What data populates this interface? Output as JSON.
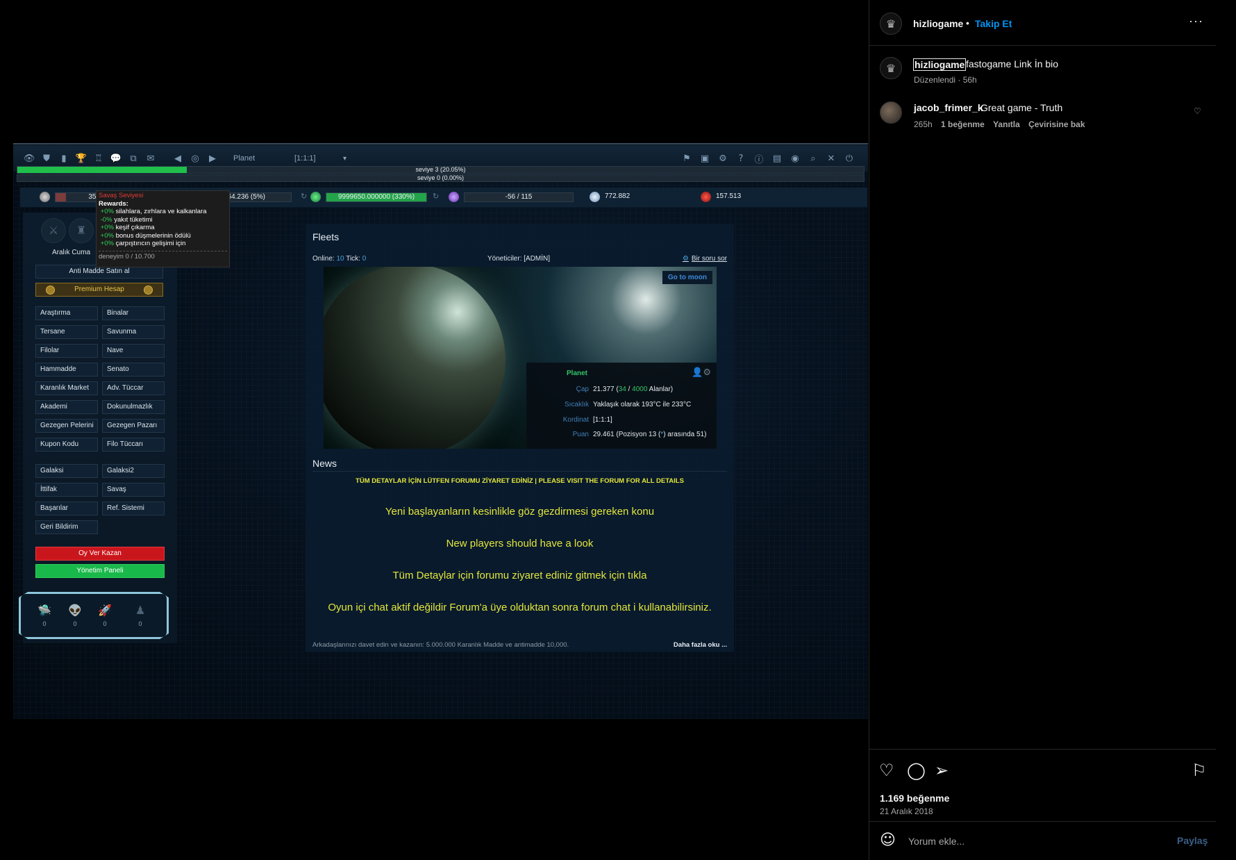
{
  "post": {
    "username": "hizliogame",
    "separator": "•",
    "follow": "Takip Et",
    "more": "···",
    "caption_username": "hizliogame",
    "caption_text": "fastogame Link İn bio",
    "caption_meta": "Düzenlendi · 56h",
    "comment": {
      "username": "jacob_frimer_k",
      "text": "Great game - Truth",
      "time": "265h",
      "likes": "1 beğenme",
      "reply": "Yanıtla",
      "translate": "Çevirisine bak"
    },
    "likes": "1.169 beğenme",
    "date": "21 Aralık 2018",
    "comment_placeholder": "Yorum ekle...",
    "share": "Paylaş",
    "icons": [
      "like-icon",
      "comment-icon",
      "share-icon",
      "save-icon",
      "emoji-icon"
    ]
  },
  "game": {
    "toolbar": {
      "planet": "Planet",
      "coord": "[1:1:1]",
      "dropdown": "▾"
    },
    "level_bars": [
      {
        "label": "seviye 3 (20.05%)",
        "progress": 0.2005
      },
      {
        "label": "seviye 0 (0.00%)",
        "progress": 0.0
      }
    ],
    "resources": {
      "metal": "353",
      "crystal": "164.236 (5%)",
      "deuterium": "9999650.000000 (330%)",
      "deuterium_progress": 1.0,
      "energy": "-56 / 115",
      "dark_matter": "772.882",
      "antimatter": "157.513"
    },
    "tooltip": {
      "title": "Savaş Seviyesi",
      "rewards": "Rewards:",
      "lines": [
        {
          "pct": "+0%",
          "text": "silahlara, zırhlara ve kalkanlara"
        },
        {
          "pct": "-0%",
          "text": "yakıt tüketimi"
        },
        {
          "pct": "+0%",
          "text": "keşif çıkarma"
        },
        {
          "pct": "+0%",
          "text": "bonus düşmelerinin ödülü"
        },
        {
          "pct": "+0%",
          "text": "çarpıştırıcın gelişimi için"
        }
      ],
      "exp": "deneyim 0 / 10.700"
    },
    "user": "Aralık Cuma",
    "menu": {
      "buy_am": "Anti Madde Satın al",
      "premium": "Premium Hesap",
      "left": [
        "Araştırma",
        "Tersane",
        "Filolar",
        "Hammadde",
        "Karanlık Market",
        "Akademi",
        "Gezegen Pelerini",
        "Kupon Kodu"
      ],
      "right": [
        "Binalar",
        "Savunma",
        "Nave",
        "Senato",
        "Adv. Tüccar",
        "Dokunulmazlık",
        "Gezegen Pazarı",
        "Filo Tüccarı"
      ],
      "left2": [
        "Galaksi",
        "İttifak",
        "Başarılar",
        "Geri Bildirim"
      ],
      "right2": [
        "Galaksi2",
        "Savaş",
        "Ref. Sistemi"
      ],
      "vote": "Oy Ver Kazan",
      "admin": "Yönetim Paneli",
      "ships": [
        "0",
        "0",
        "0",
        "0"
      ]
    },
    "main": {
      "fleets": "Fleets",
      "online_label": "Online:",
      "online_value": "10",
      "tick_label": "Tick:",
      "tick_value": "0",
      "admins": "Yöneticiler: [ADMİN]",
      "ask": "Bir soru sor",
      "go_moon": "Go to moon",
      "planet": {
        "title": "Planet",
        "cap_label": "Çap",
        "cap_pre": "21.377 (",
        "cap_used": "34",
        "cap_sep": " / ",
        "cap_total": "4000",
        "cap_post": " Alanlar)",
        "temp_label": "Sıcaklık",
        "temp": "Yaklaşık olarak 193°C ile 233°C",
        "coord_label": "Kordinat",
        "coord": "[1:1:1]",
        "score_label": "Puan",
        "score_pre": "29.461 (Pozisyon 13 (",
        "score_star": "*",
        "score_post": ") arasında 51)"
      },
      "news": "News",
      "news_forum": "TÜM DETAYLAR İÇİN LÜTFEN FORUMU ZİYARET EDİNİZ | PLEASE VISIT THE FORUM FOR ALL DETAILS",
      "news_lines": [
        "Yeni başlayanların kesinlikle göz gezdirmesi gereken konu",
        "New players should have a look",
        "Tüm Detaylar için forumu ziyaret ediniz gitmek için tıkla",
        "Oyun içi chat aktif değildir Forum'a üye olduktan sonra forum chat i kullanabilirsiniz."
      ],
      "footer": "Arkadaşlarınızı davet edin ve kazanın: 5.000.000 Karanlık Madde ve antimadde 10,000.",
      "read_more": "Daha fazla oku ..."
    }
  },
  "colors": {
    "accent": "#0095f6",
    "news_yellow": "#e3e63c",
    "progress_green": "#1fbf4a",
    "vote_red": "#c9161c",
    "admin_green": "#19b84a"
  }
}
